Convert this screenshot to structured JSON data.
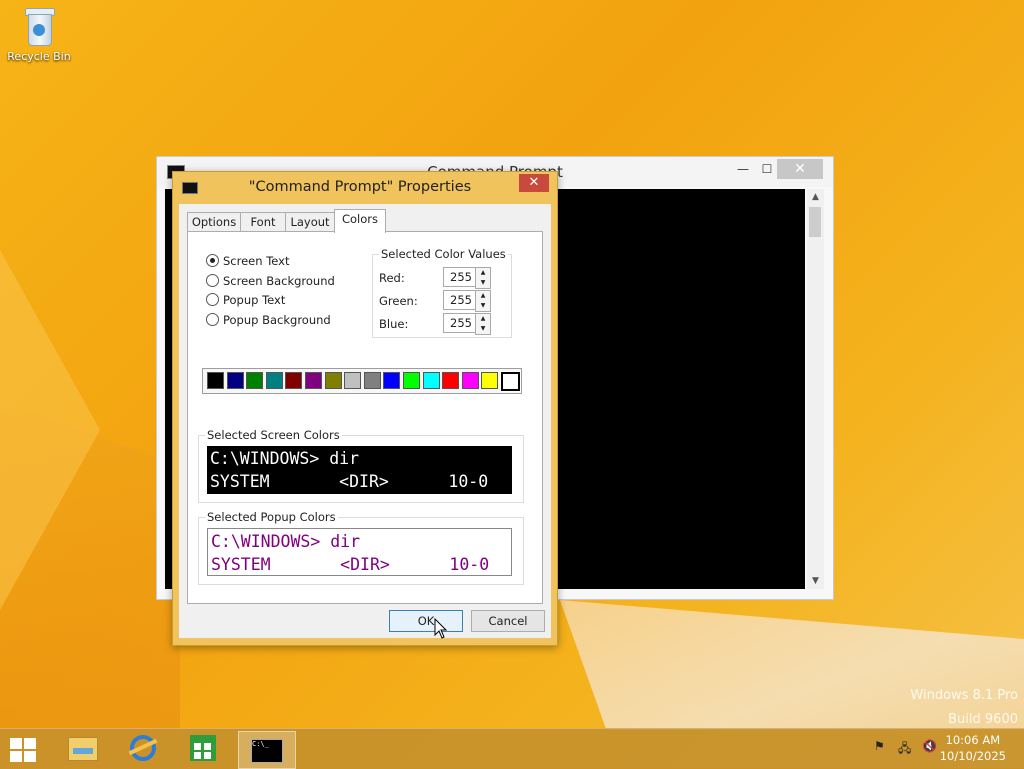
{
  "desktop": {
    "recycle_bin_label": "Recycle Bin",
    "watermark_line1": "Windows 8.1 Pro",
    "watermark_line2": "Build 9600"
  },
  "cmd_window": {
    "title": "Command Prompt",
    "minimize_glyph": "—",
    "maximize_glyph": "☐",
    "close_glyph": "✕",
    "scroll_up_glyph": "▲",
    "scroll_down_glyph": "▼"
  },
  "dialog": {
    "title": "\"Command Prompt\" Properties",
    "close_glyph": "✕",
    "tabs": [
      {
        "label": "Options"
      },
      {
        "label": "Font"
      },
      {
        "label": "Layout"
      },
      {
        "label": "Colors"
      }
    ],
    "active_tab": "Colors",
    "radios": [
      {
        "label": "Screen Text",
        "checked": true
      },
      {
        "label": "Screen Background",
        "checked": false
      },
      {
        "label": "Popup Text",
        "checked": false
      },
      {
        "label": "Popup Background",
        "checked": false
      }
    ],
    "color_values": {
      "legend": "Selected Color Values",
      "red_label": "Red:",
      "red_value": "255",
      "green_label": "Green:",
      "green_value": "255",
      "blue_label": "Blue:",
      "blue_value": "255"
    },
    "palette": [
      "#000000",
      "#000080",
      "#008000",
      "#008080",
      "#800000",
      "#800080",
      "#808000",
      "#c0c0c0",
      "#808080",
      "#0000ff",
      "#00ff00",
      "#00ffff",
      "#ff0000",
      "#ff00ff",
      "#ffff00",
      "#ffffff"
    ],
    "selected_palette_index": 15,
    "screen_colors": {
      "legend": "Selected Screen Colors",
      "line1": "C:\\WINDOWS> dir",
      "line2": "SYSTEM       <DIR>      10-0"
    },
    "popup_colors": {
      "legend": "Selected Popup Colors",
      "line1": "C:\\WINDOWS> dir",
      "line2": "SYSTEM       <DIR>      10-0"
    },
    "ok_label": "OK",
    "cancel_label": "Cancel"
  },
  "taskbar": {
    "cmd_glyph_text": "C:\\_",
    "tray_flag_glyph": "⚑",
    "tray_network_glyph": "🖧",
    "tray_volume_glyph": "🔇",
    "time": "10:06 AM",
    "date": "10/10/2025"
  }
}
